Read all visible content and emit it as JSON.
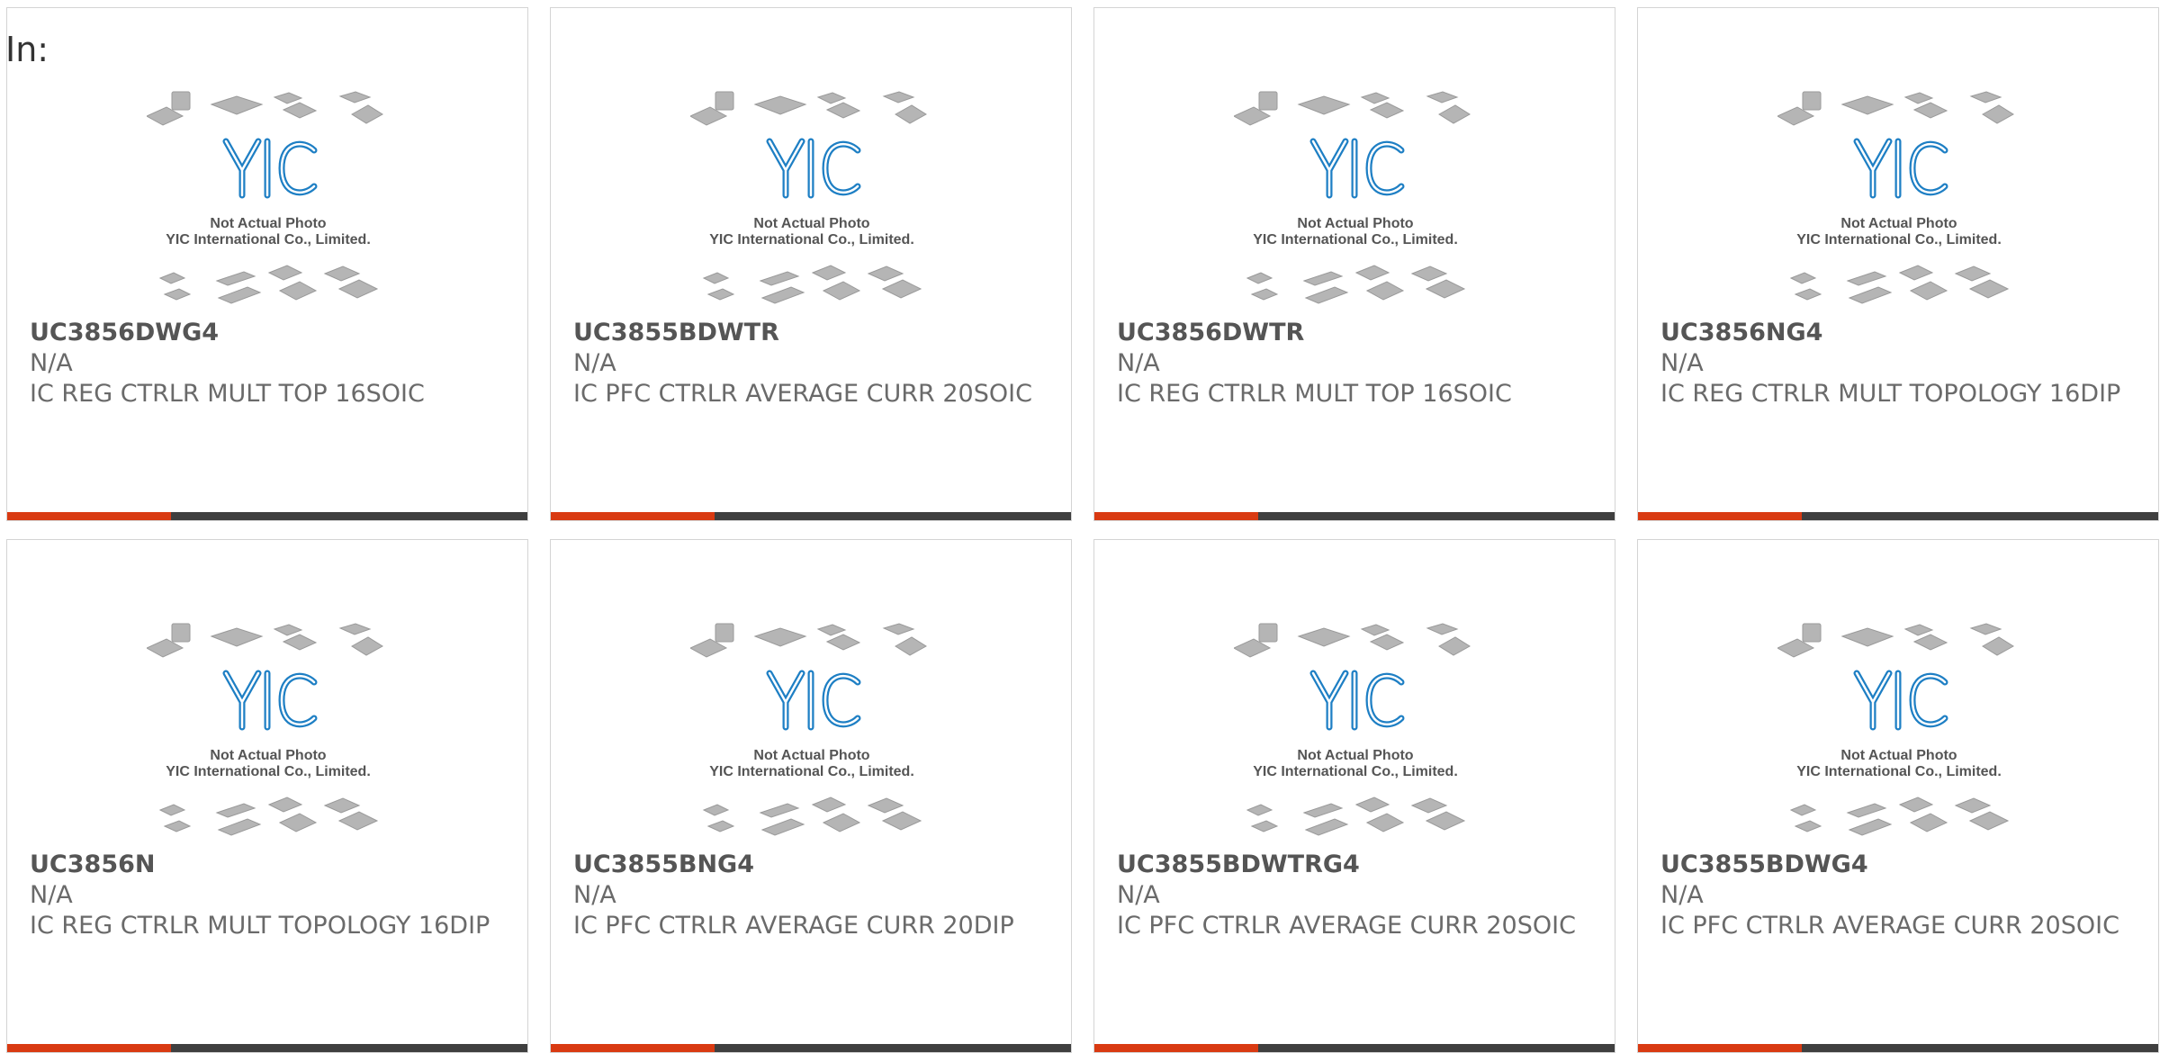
{
  "page_label": "In:",
  "thumbnail": {
    "logo_text": "YIC",
    "caption_line1": "Not Actual Photo",
    "caption_line2": "YIC International Co., Limited."
  },
  "colors": {
    "accent": "#d93a12",
    "bar": "#3f3f3f",
    "logo": "#1e7fc4",
    "border": "#d4d4d4"
  },
  "products": [
    {
      "part": "UC3856DWG4",
      "mfr": "N/A",
      "desc": "IC REG CTRLR MULT TOP 16SOIC"
    },
    {
      "part": "UC3855BDWTR",
      "mfr": "N/A",
      "desc": "IC PFC CTRLR AVERAGE CURR 20SOIC"
    },
    {
      "part": "UC3856DWTR",
      "mfr": "N/A",
      "desc": "IC REG CTRLR MULT TOP 16SOIC"
    },
    {
      "part": "UC3856NG4",
      "mfr": "N/A",
      "desc": "IC REG CTRLR MULT TOPOLOGY 16DIP"
    },
    {
      "part": "UC3856N",
      "mfr": "N/A",
      "desc": "IC REG CTRLR MULT TOPOLOGY 16DIP"
    },
    {
      "part": "UC3855BNG4",
      "mfr": "N/A",
      "desc": "IC PFC CTRLR AVERAGE CURR 20DIP"
    },
    {
      "part": "UC3855BDWTRG4",
      "mfr": "N/A",
      "desc": "IC PFC CTRLR AVERAGE CURR 20SOIC"
    },
    {
      "part": "UC3855BDWG4",
      "mfr": "N/A",
      "desc": "IC PFC CTRLR AVERAGE CURR 20SOIC"
    }
  ]
}
